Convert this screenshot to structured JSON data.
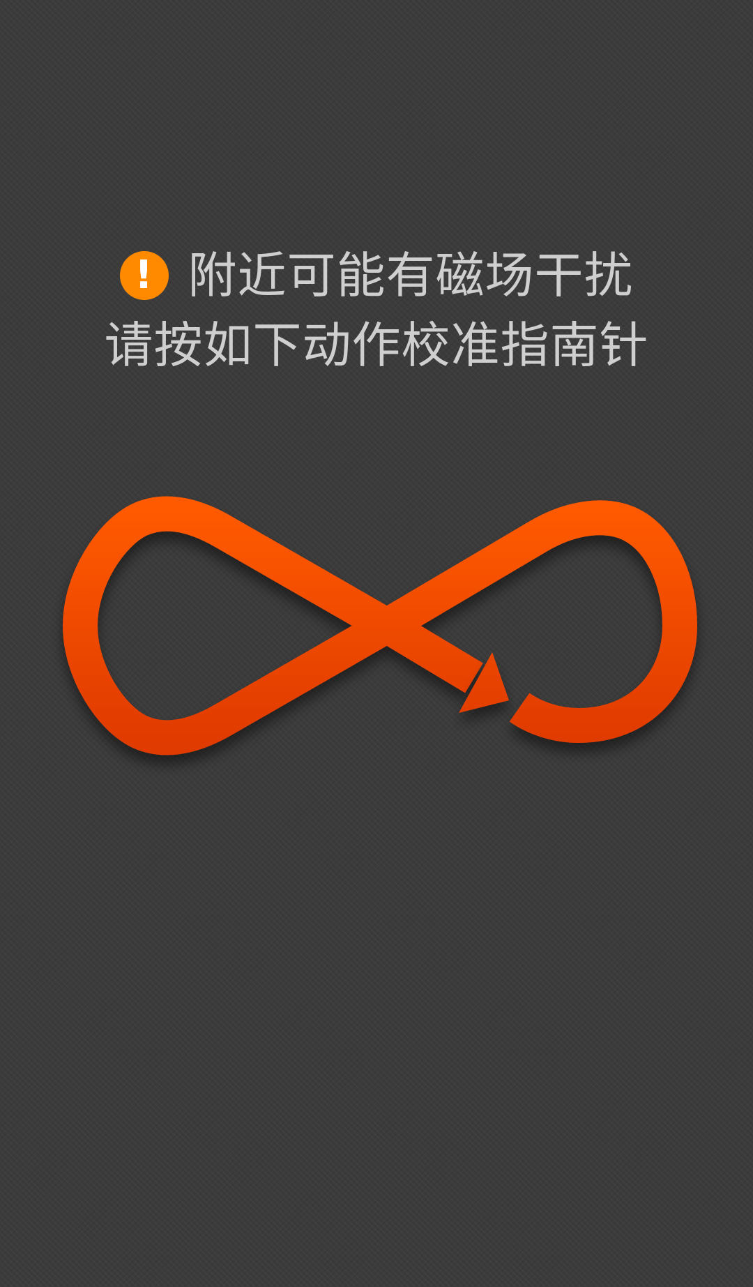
{
  "calibration": {
    "warning_icon": "exclamation-icon",
    "warning_glyph": "!",
    "line1": "附近可能有磁场干扰",
    "line2": "请按如下动作校准指南针"
  },
  "colors": {
    "background": "#3b3b3b",
    "text": "#cfcfcf",
    "accent_top": "#ff5a00",
    "accent_bottom": "#e03a00",
    "warning_icon_bg": "#ff8a00"
  },
  "gesture_graphic": "figure-eight-arrow-icon"
}
